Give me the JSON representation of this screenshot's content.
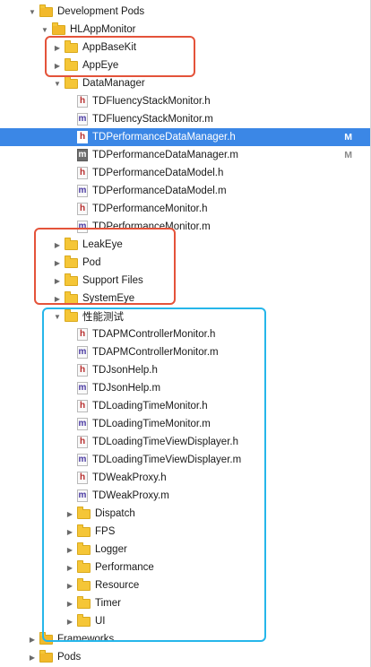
{
  "tree": [
    {
      "label": "Development Pods",
      "kind": "folder",
      "indent": 0,
      "disclosure": "open"
    },
    {
      "label": "HLAppMonitor",
      "kind": "folder",
      "indent": 1,
      "disclosure": "open"
    },
    {
      "label": "AppBaseKit",
      "kind": "folder",
      "indent": 2,
      "disclosure": "closed"
    },
    {
      "label": "AppEye",
      "kind": "folder",
      "indent": 2,
      "disclosure": "closed"
    },
    {
      "label": "DataManager",
      "kind": "folder",
      "indent": 2,
      "disclosure": "open"
    },
    {
      "label": "TDFluencyStackMonitor.h",
      "kind": "h",
      "indent": 3
    },
    {
      "label": "TDFluencyStackMonitor.m",
      "kind": "m",
      "indent": 3
    },
    {
      "label": "TDPerformanceDataManager.h",
      "kind": "h",
      "indent": 3,
      "selected": true,
      "status": "M"
    },
    {
      "label": "TDPerformanceDataManager.m",
      "kind": "m",
      "indent": 3,
      "dark": true,
      "status": "M"
    },
    {
      "label": "TDPerformanceDataModel.h",
      "kind": "h",
      "indent": 3
    },
    {
      "label": "TDPerformanceDataModel.m",
      "kind": "m",
      "indent": 3
    },
    {
      "label": "TDPerformanceMonitor.h",
      "kind": "h",
      "indent": 3
    },
    {
      "label": "TDPerformanceMonitor.m",
      "kind": "m",
      "indent": 3
    },
    {
      "label": "LeakEye",
      "kind": "folder",
      "indent": 2,
      "disclosure": "closed"
    },
    {
      "label": "Pod",
      "kind": "folder",
      "indent": 2,
      "disclosure": "closed"
    },
    {
      "label": "Support Files",
      "kind": "folder",
      "indent": 2,
      "disclosure": "closed"
    },
    {
      "label": "SystemEye",
      "kind": "folder",
      "indent": 2,
      "disclosure": "closed"
    },
    {
      "label": "性能测试",
      "kind": "folder",
      "indent": 2,
      "disclosure": "open"
    },
    {
      "label": "TDAPMControllerMonitor.h",
      "kind": "h",
      "indent": 3
    },
    {
      "label": "TDAPMControllerMonitor.m",
      "kind": "m",
      "indent": 3
    },
    {
      "label": "TDJsonHelp.h",
      "kind": "h",
      "indent": 3
    },
    {
      "label": "TDJsonHelp.m",
      "kind": "m",
      "indent": 3
    },
    {
      "label": "TDLoadingTimeMonitor.h",
      "kind": "h",
      "indent": 3
    },
    {
      "label": "TDLoadingTimeMonitor.m",
      "kind": "m",
      "indent": 3
    },
    {
      "label": "TDLoadingTimeViewDisplayer.h",
      "kind": "h",
      "indent": 3
    },
    {
      "label": "TDLoadingTimeViewDisplayer.m",
      "kind": "m",
      "indent": 3
    },
    {
      "label": "TDWeakProxy.h",
      "kind": "h",
      "indent": 3
    },
    {
      "label": "TDWeakProxy.m",
      "kind": "m",
      "indent": 3
    },
    {
      "label": "Dispatch",
      "kind": "folder",
      "indent": 3,
      "disclosure": "closed"
    },
    {
      "label": "FPS",
      "kind": "folder",
      "indent": 3,
      "disclosure": "closed"
    },
    {
      "label": "Logger",
      "kind": "folder",
      "indent": 3,
      "disclosure": "closed"
    },
    {
      "label": "Performance",
      "kind": "folder",
      "indent": 3,
      "disclosure": "closed"
    },
    {
      "label": "Resource",
      "kind": "folder",
      "indent": 3,
      "disclosure": "closed"
    },
    {
      "label": "Timer",
      "kind": "folder",
      "indent": 3,
      "disclosure": "closed"
    },
    {
      "label": "UI",
      "kind": "folder",
      "indent": 3,
      "disclosure": "closed"
    },
    {
      "label": "Frameworks",
      "kind": "folder",
      "indent": 0,
      "disclosure": "closed"
    },
    {
      "label": "Pods",
      "kind": "folder",
      "indent": 0,
      "disclosure": "closed"
    }
  ],
  "file_letters": {
    "h": "h",
    "m": "m"
  },
  "colors": {
    "selection": "#3b87e6",
    "annotation_red": "#e4533a",
    "annotation_blue": "#26b6ea"
  }
}
